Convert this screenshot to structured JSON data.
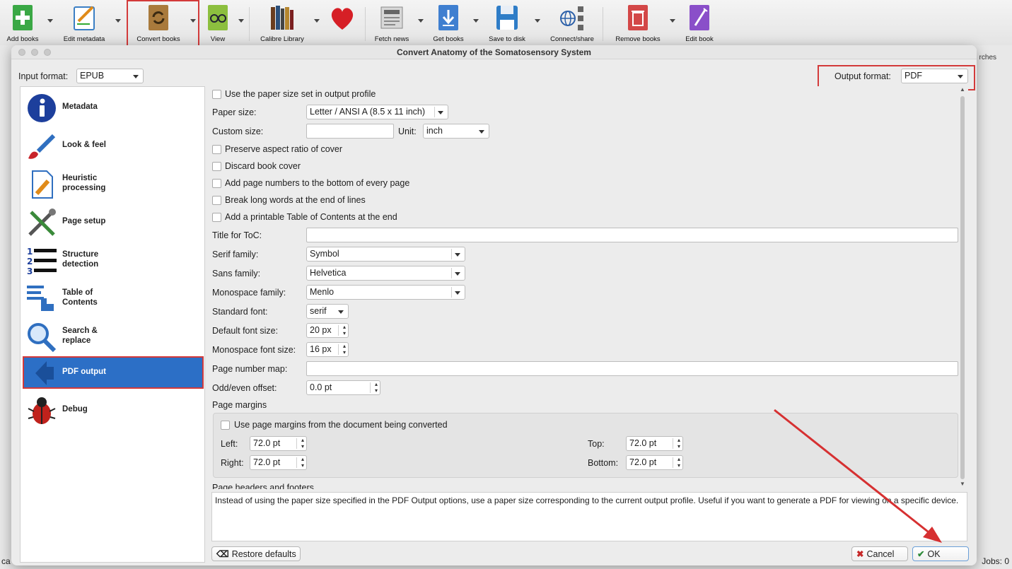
{
  "toolbar": {
    "items": [
      {
        "label": "Add books",
        "icon": "add-books-icon"
      },
      {
        "label": "Edit metadata",
        "icon": "edit-metadata-icon"
      },
      {
        "label": "Convert books",
        "icon": "convert-books-icon"
      },
      {
        "label": "View",
        "icon": "view-icon"
      },
      {
        "label": "Calibre Library",
        "icon": "calibre-library-icon"
      },
      {
        "label": "",
        "icon": "heart-icon"
      },
      {
        "label": "Fetch news",
        "icon": "fetch-news-icon"
      },
      {
        "label": "Get books",
        "icon": "get-books-icon"
      },
      {
        "label": "Save to disk",
        "icon": "save-to-disk-icon"
      },
      {
        "label": "Connect/share",
        "icon": "connect-share-icon"
      },
      {
        "label": "Remove books",
        "icon": "remove-books-icon"
      },
      {
        "label": "Edit book",
        "icon": "edit-book-icon"
      }
    ]
  },
  "background": {
    "searches_fragment": "rches",
    "jobs": "Jobs: 0",
    "ca": "ca"
  },
  "dialog": {
    "title": "Convert Anatomy of the Somatosensory System",
    "input_format_label": "Input format:",
    "input_format_value": "EPUB",
    "output_format_label": "Output format:",
    "output_format_value": "PDF",
    "sidebar": [
      {
        "label": "Metadata",
        "icon": "metadata-info-icon",
        "selected": false
      },
      {
        "label": "Look & feel",
        "icon": "look-and-feel-brush-icon",
        "selected": false
      },
      {
        "label": "Heuristic processing",
        "icon": "heuristic-processing-icon",
        "selected": false
      },
      {
        "label": "Page setup",
        "icon": "page-setup-tools-icon",
        "selected": false
      },
      {
        "label": "Structure detection",
        "icon": "structure-detection-icon",
        "selected": false
      },
      {
        "label": "Table of Contents",
        "icon": "table-of-contents-icon",
        "selected": false
      },
      {
        "label": "Search & replace",
        "icon": "search-replace-icon",
        "selected": false
      },
      {
        "label": "PDF output",
        "icon": "pdf-output-icon",
        "selected": true
      },
      {
        "label": "Debug",
        "icon": "debug-bug-icon",
        "selected": false
      }
    ],
    "pdf_options": {
      "use_paper_size_profile": "Use the paper size set in output profile",
      "paper_size_label": "Paper size:",
      "paper_size_value": "Letter / ANSI A (8.5 x 11 inch)",
      "custom_size_label": "Custom size:",
      "custom_size_value": "",
      "unit_label": "Unit:",
      "unit_value": "inch",
      "preserve_aspect": "Preserve aspect ratio of cover",
      "discard_cover": "Discard book cover",
      "add_page_numbers": "Add page numbers to the bottom of every page",
      "break_long_words": "Break long words at the end of lines",
      "add_toc": "Add a printable Table of Contents at the end",
      "toc_title_label": "Title for ToC:",
      "toc_title_value": "",
      "serif_label": "Serif family:",
      "serif_value": "Symbol",
      "sans_label": "Sans family:",
      "sans_value": "Helvetica",
      "mono_label": "Monospace family:",
      "mono_value": "Menlo",
      "std_font_label": "Standard font:",
      "std_font_value": "serif",
      "default_size_label": "Default font size:",
      "default_size_value": "20 px",
      "mono_size_label": "Monospace font size:",
      "mono_size_value": "16 px",
      "page_map_label": "Page number map:",
      "page_map_value": "",
      "odd_even_label": "Odd/even offset:",
      "odd_even_value": "0.0 pt",
      "page_margins_label": "Page  margins",
      "use_doc_margins": "Use page margins from the document being converted",
      "left_label": "Left:",
      "left_value": "72.0 pt",
      "top_label": "Top:",
      "top_value": "72.0 pt",
      "right_label": "Right:",
      "right_value": "72.0 pt",
      "bottom_label": "Bottom:",
      "bottom_value": "72.0 pt",
      "headers_footers_label": "Page headers and footers"
    },
    "help_text": "Instead of using the paper size specified in the PDF Output options, use a paper size corresponding to the current output profile. Useful if you want to generate a PDF for viewing on a specific device.",
    "restore_defaults": "Restore defaults",
    "cancel": "Cancel",
    "ok": "OK"
  },
  "colors": {
    "highlight_red": "#d33a3a",
    "selection_blue": "#2c6fc6"
  }
}
